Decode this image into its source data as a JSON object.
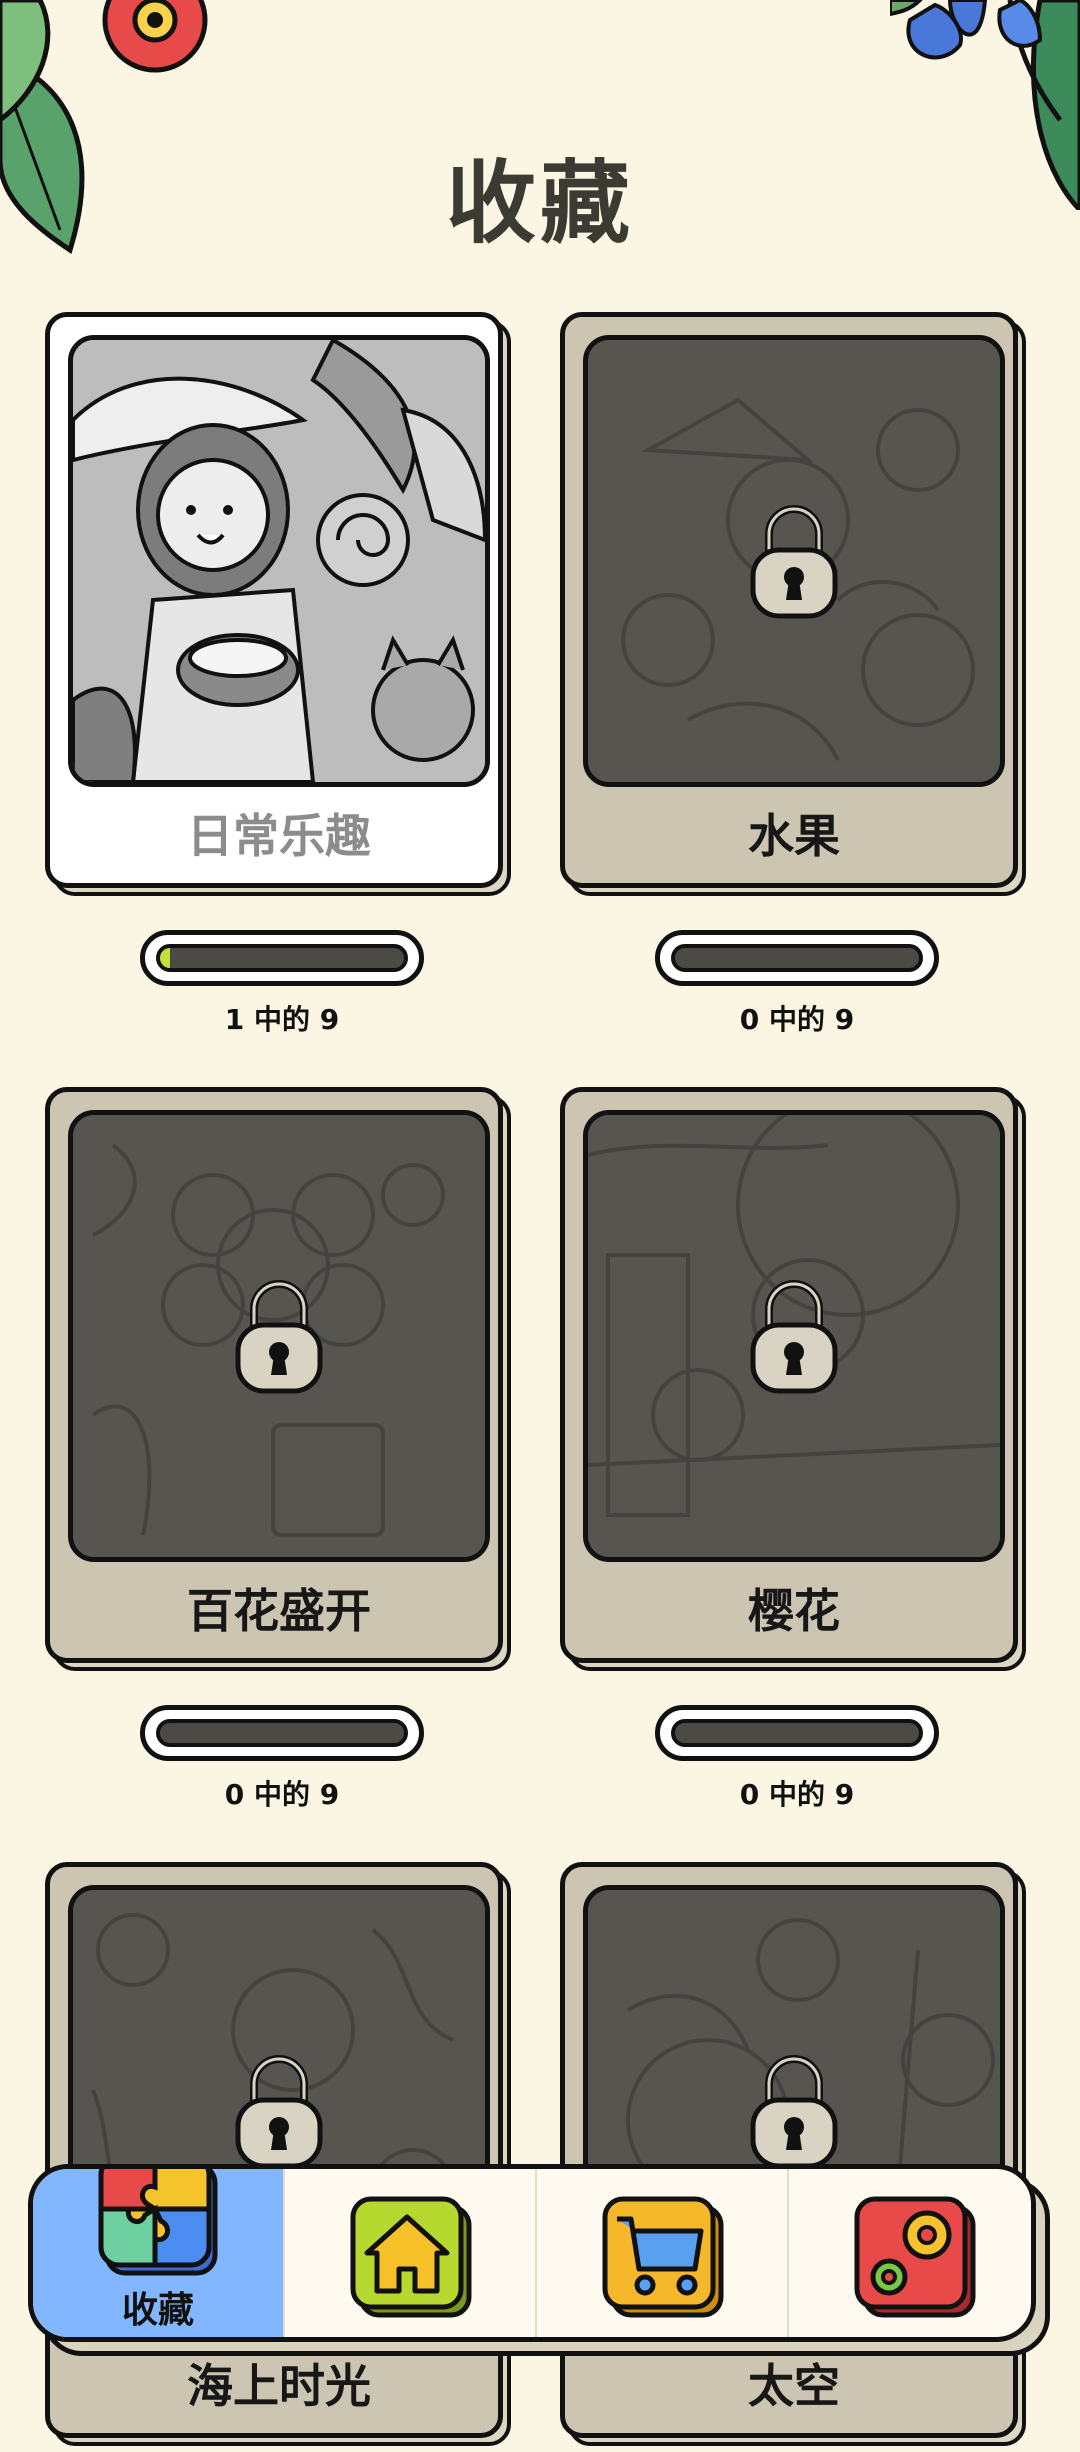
{
  "page": {
    "title": "收藏"
  },
  "collections": [
    {
      "name": "日常乐趣",
      "unlocked": true,
      "progress_text": "1 中的 9",
      "completed": 1,
      "total": 9
    },
    {
      "name": "水果",
      "unlocked": false,
      "progress_text": "0 中的 9",
      "completed": 0,
      "total": 9
    },
    {
      "name": "百花盛开",
      "unlocked": false,
      "progress_text": "0 中的 9",
      "completed": 0,
      "total": 9
    },
    {
      "name": "樱花",
      "unlocked": false,
      "progress_text": "0 中的 9",
      "completed": 0,
      "total": 9
    },
    {
      "name": "海上时光",
      "unlocked": false
    },
    {
      "name": "太空",
      "unlocked": false
    }
  ],
  "nav": {
    "items": [
      {
        "label": "收藏",
        "icon": "puzzle-icon",
        "active": true
      },
      {
        "label": "",
        "icon": "home-icon",
        "active": false
      },
      {
        "label": "",
        "icon": "cart-icon",
        "active": false
      },
      {
        "label": "",
        "icon": "settings-gears-icon",
        "active": false
      }
    ]
  },
  "colors": {
    "background": "#fbf5e3",
    "nav_active": "#82b6ff",
    "progress_fill": "#c1e23b",
    "locked_card": "#cbc5b1"
  }
}
